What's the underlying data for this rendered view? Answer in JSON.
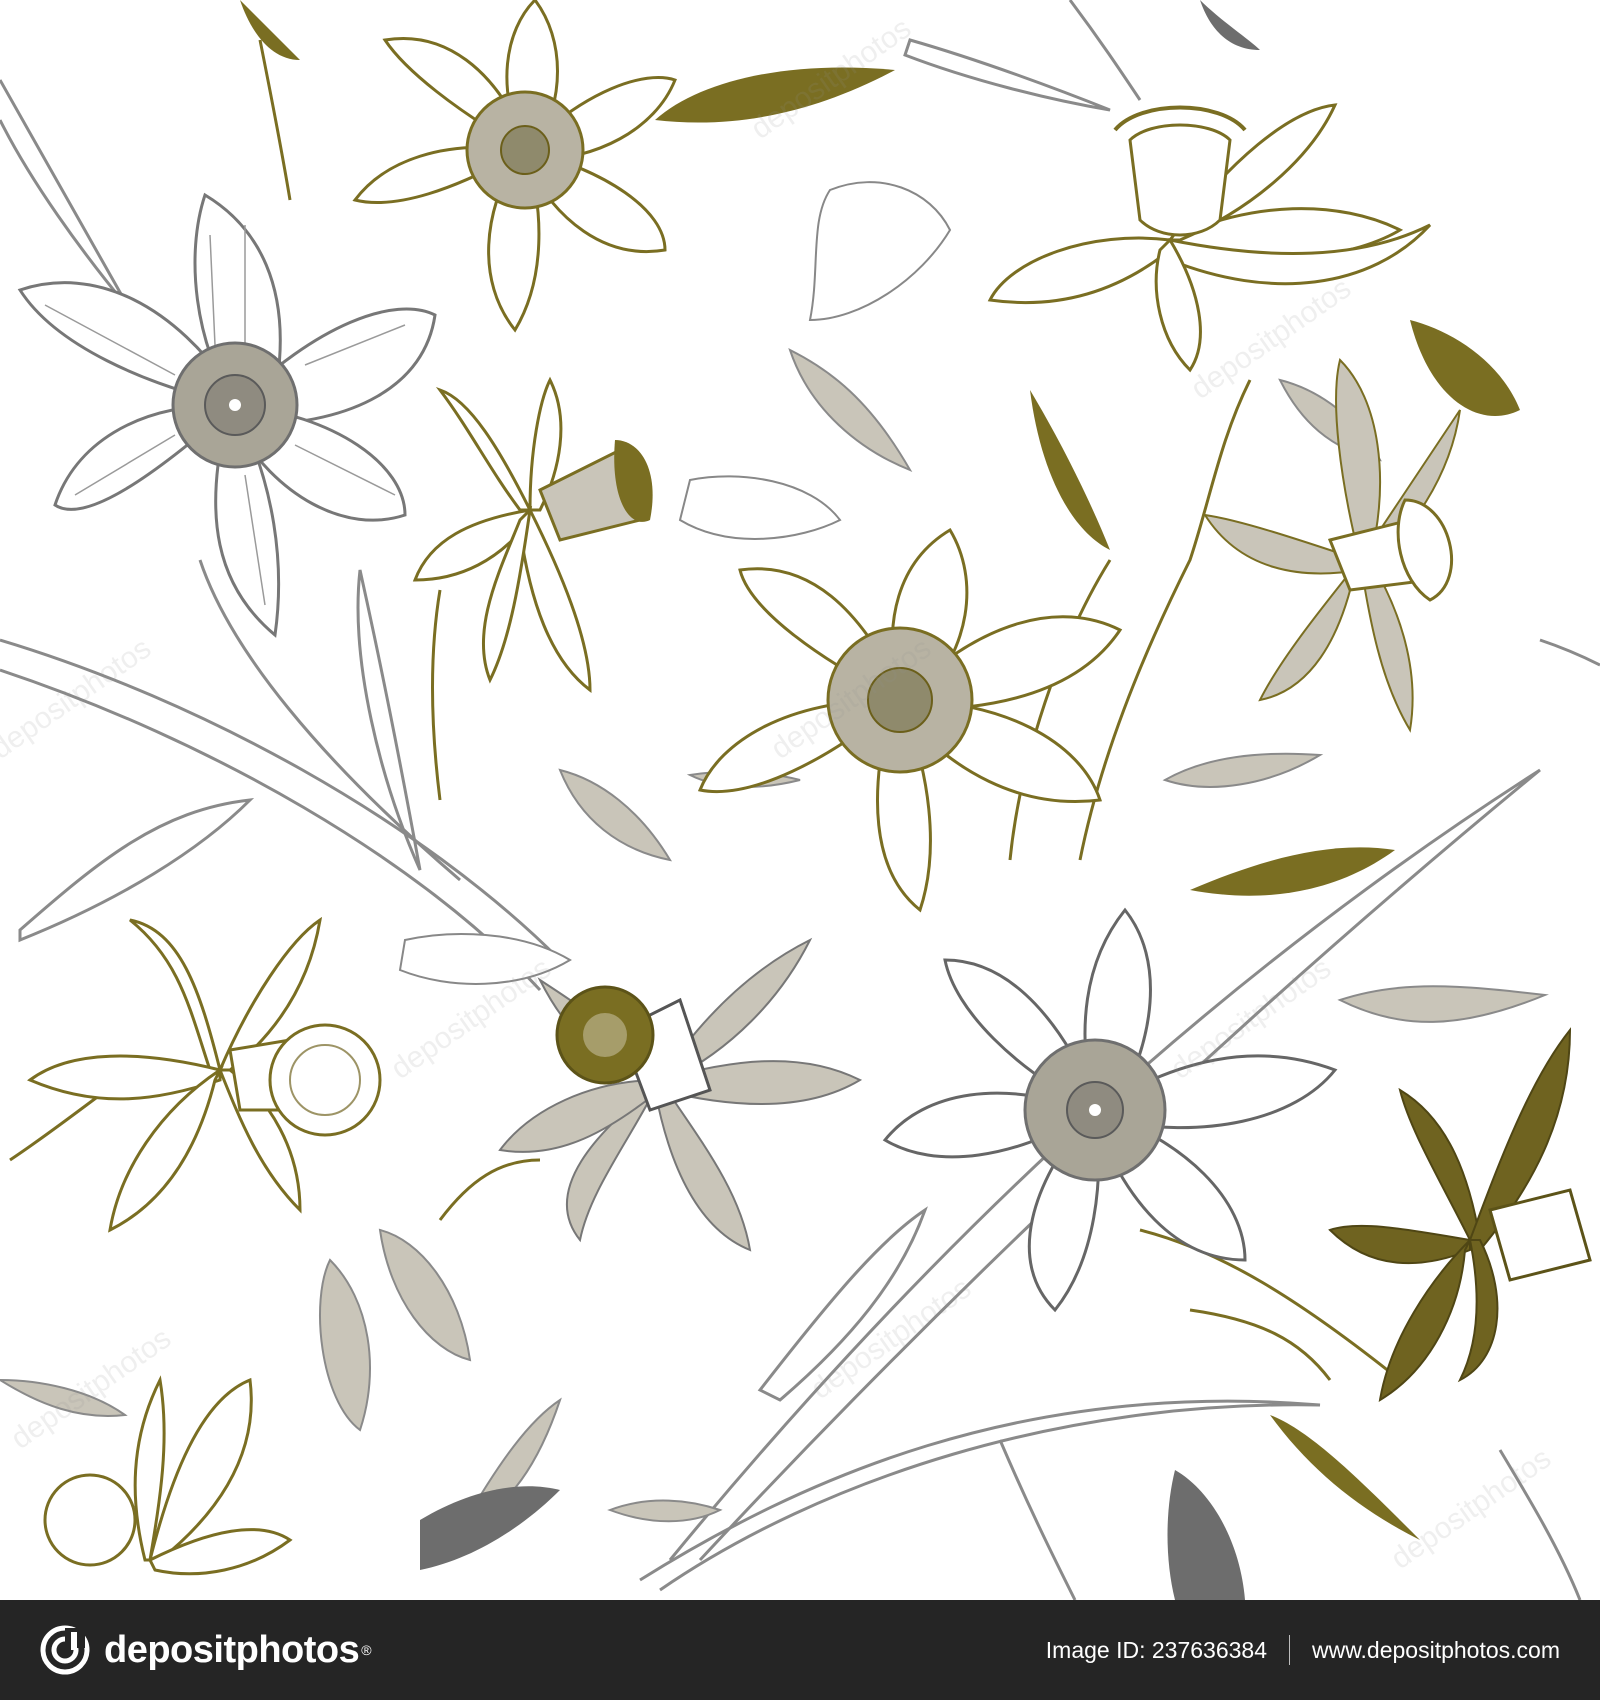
{
  "image": {
    "subject": "Seamless daffodil (narcissus) pattern",
    "colors": {
      "background": "#ffffff",
      "olive": "#7a6e22",
      "olive_dark": "#6b5f1a",
      "grey_fill": "#c9c5b9",
      "grey_line": "#7b7b7b",
      "dark_grey": "#6d6d6d"
    }
  },
  "watermark": {
    "text": "depositphotos"
  },
  "footer": {
    "brand": "depositphotos",
    "registered": "®",
    "image_id_label": "Image ID: 237636384",
    "site_url": "www.depositphotos.com",
    "background": "#252525"
  }
}
